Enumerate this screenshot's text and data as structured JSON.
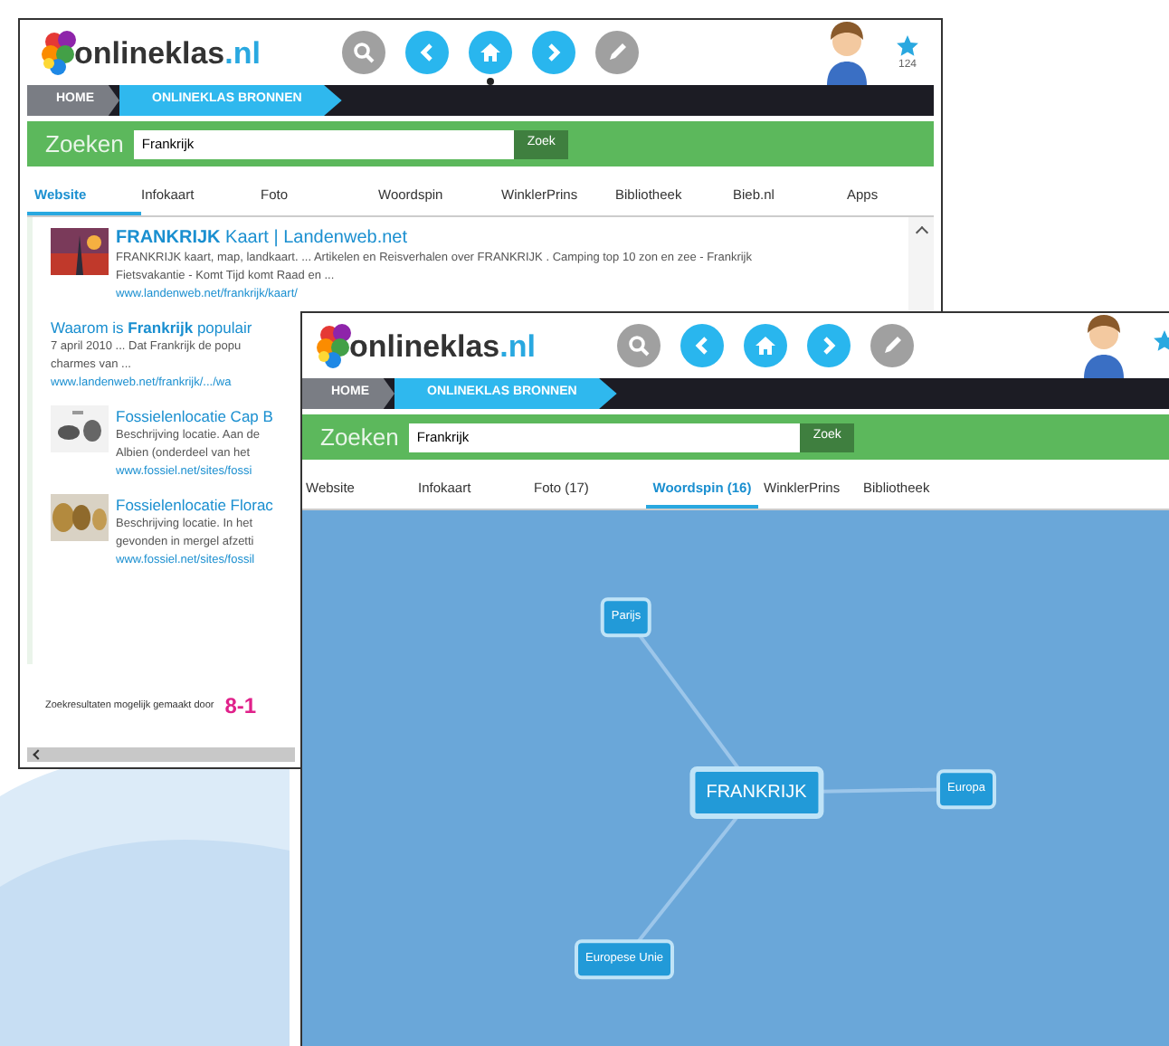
{
  "back_window": {
    "logo": {
      "name": "onlineklas",
      "tld": ".nl"
    },
    "nav_buttons": [
      {
        "disabled": true,
        "selected": false
      },
      {
        "disabled": false,
        "selected": false
      },
      {
        "disabled": false,
        "selected": true
      },
      {
        "disabled": false,
        "selected": false
      },
      {
        "disabled": true,
        "selected": false
      }
    ],
    "star_count": "124",
    "breadcrumbs": [
      {
        "label": "HOME",
        "selected": false
      },
      {
        "label": "ONLINEKLAS BRONNEN",
        "selected": true
      }
    ],
    "search": {
      "label": "Zoeken",
      "value": "Frankrijk",
      "button": "Zoek"
    },
    "tabs": [
      {
        "label": "Website",
        "selected": true
      },
      {
        "label": "Infokaart",
        "selected": false
      },
      {
        "label": "Foto",
        "selected": false
      },
      {
        "label": "Woordspin",
        "selected": false
      },
      {
        "label": "WinklerPrins",
        "selected": false
      },
      {
        "label": "Bibliotheek",
        "selected": false
      },
      {
        "label": "Bieb.nl",
        "selected": false
      },
      {
        "label": "Apps",
        "selected": false
      }
    ],
    "results": [
      {
        "title": "**FRANKRIJK** Kaart | Landenweb.net",
        "snippet": [
          "FRANKRIJK kaart, map, landkaart. ... Artikelen en Reisverhalen over FRANKRIJK . Camping top 10 zon en zee - Frankrijk",
          "Fietsvakantie - Komt Tijd komt Raad en ..."
        ],
        "url": "www.landenweb.net/frankrijk/kaart/",
        "image": {
          "kind": "picture"
        }
      },
      {
        "title": "Waarom is **Frankrijk** populair",
        "snippet": [
          "7 april 2010 ... Dat Frankrijk de popu",
          "charmes van ..."
        ],
        "url": "www.landenweb.net/frankrijk/.../wa"
      },
      {
        "title": "Fossielenlocatie Cap B",
        "snippet": [
          "Beschrijving locatie. Aan de",
          "Albien (onderdeel van het"
        ],
        "url": "www.fossiel.net/sites/fossi",
        "image": {
          "kind": "picture"
        }
      },
      {
        "title": "Fossielenlocatie Florac",
        "snippet": [
          "Beschrijving locatie. In het",
          "gevonden in mergel afzetti"
        ],
        "url": "www.fossiel.net/sites/fossil",
        "image": {
          "kind": "picture"
        }
      }
    ],
    "footer": {
      "text": "Zoekresultaten mogelijk gemaakt door",
      "brand": "8-1"
    }
  },
  "front_window": {
    "logo": {
      "name": "onlineklas",
      "tld": ".nl"
    },
    "nav_buttons": [
      {
        "disabled": true,
        "selected": false
      },
      {
        "disabled": false,
        "selected": false
      },
      {
        "disabled": false,
        "selected": false
      },
      {
        "disabled": false,
        "selected": false
      },
      {
        "disabled": true,
        "selected": false
      }
    ],
    "breadcrumbs": [
      {
        "label": "HOME",
        "selected": false
      },
      {
        "label": "ONLINEKLAS BRONNEN",
        "selected": true
      }
    ],
    "search": {
      "label": "Zoeken",
      "value": "Frankrijk",
      "button": "Zoek"
    },
    "tabs": [
      {
        "label": "Website",
        "selected": false
      },
      {
        "label": "Infokaart",
        "selected": false
      },
      {
        "label": "Foto (17)",
        "selected": false
      },
      {
        "label": "Woordspin (16)",
        "selected": true
      },
      {
        "label": "WinklerPrins",
        "selected": false
      },
      {
        "label": "Bibliotheek",
        "selected": false
      }
    ],
    "woordspin": {
      "center": "FRANKRIJK",
      "nodes": [
        {
          "label": "Parijs"
        },
        {
          "label": "Europa"
        },
        {
          "label": "Europese Unie"
        }
      ]
    }
  }
}
